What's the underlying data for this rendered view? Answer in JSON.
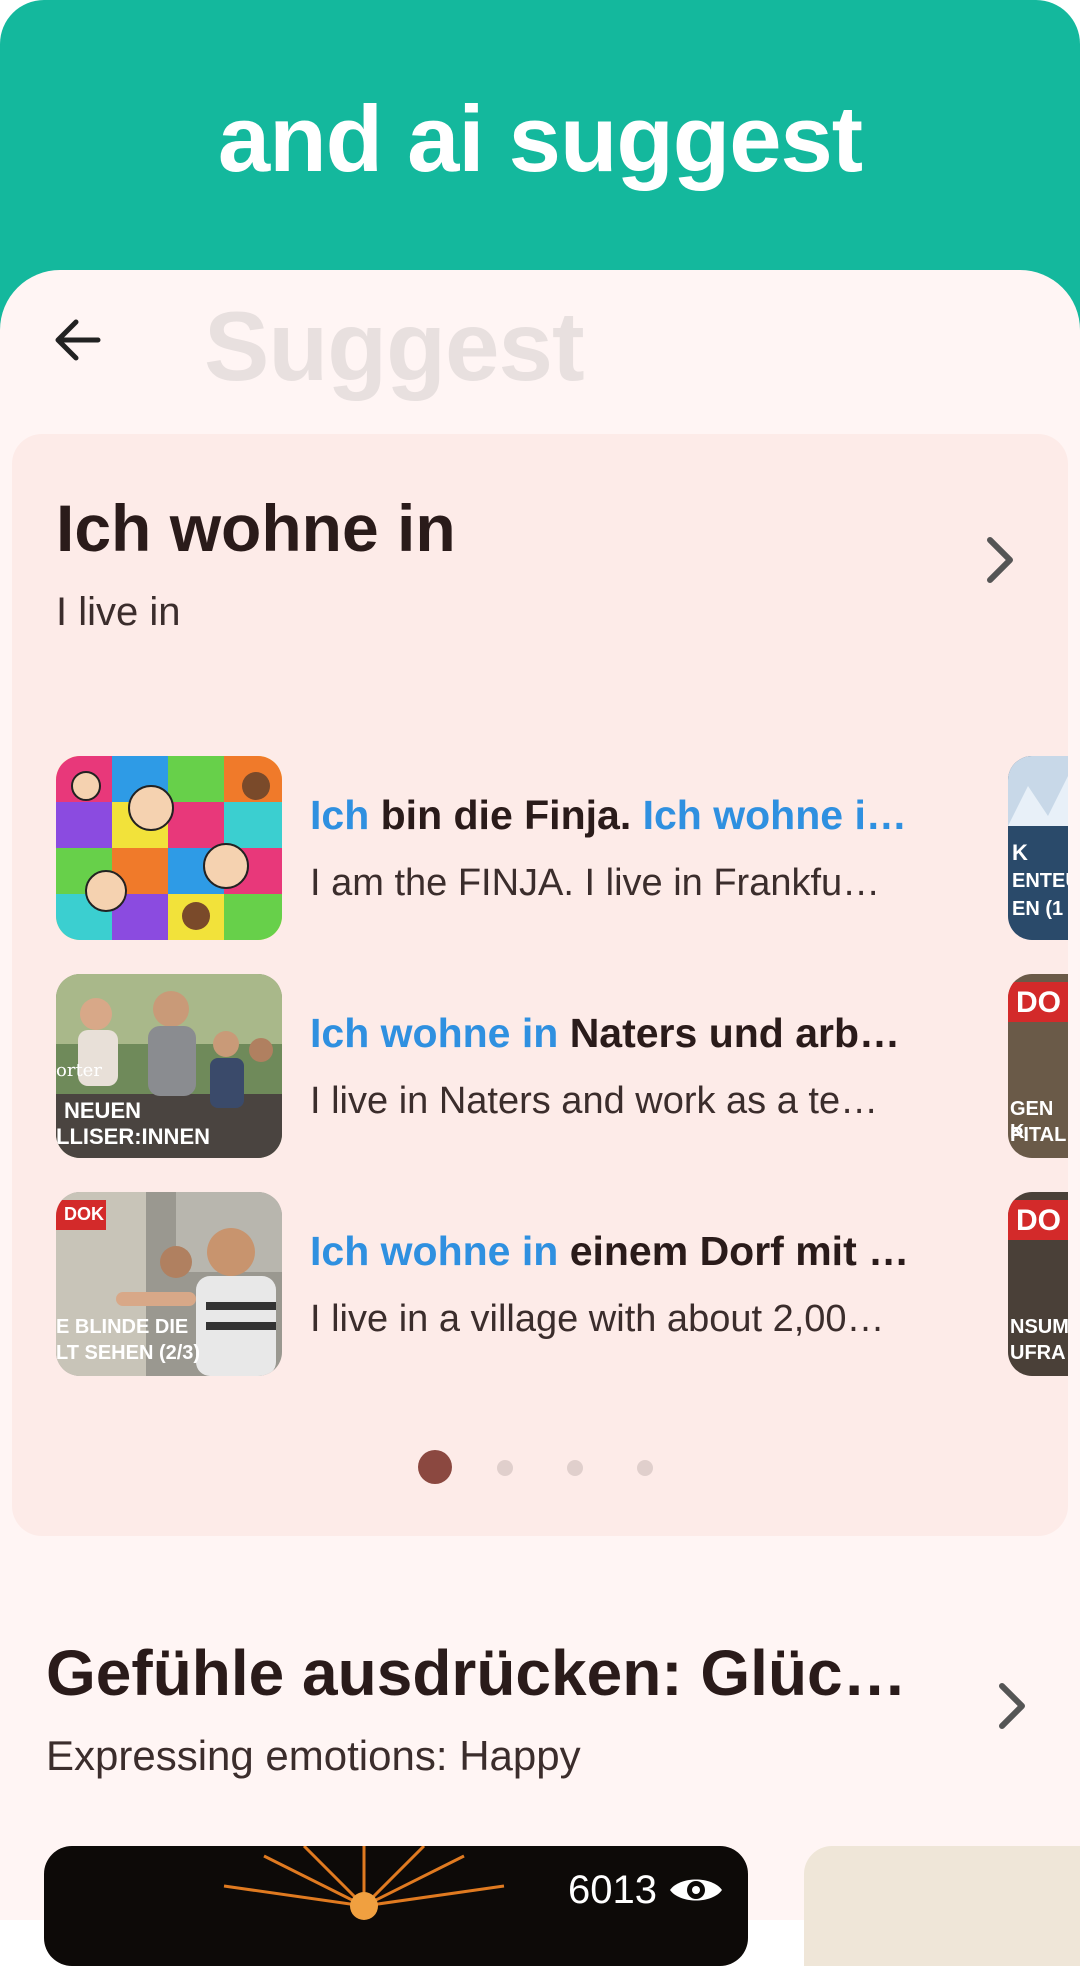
{
  "banner": {
    "title": "and ai suggest",
    "color": "#14b89d"
  },
  "header": {
    "ghost_title": "Suggest",
    "back_icon": "arrow-left-icon"
  },
  "section1": {
    "title": "Ich wohne in",
    "subtitle": "I live in",
    "items": [
      {
        "title_hl1": "Ich",
        "title_mid": " bin die Finja. ",
        "title_hl2": "Ich wohne i…",
        "subtitle": "I am the FINJA. I live in Frankfu…"
      },
      {
        "title_hl1": "Ich wohne in",
        "title_mid": " Naters und arb…",
        "title_hl2": "",
        "subtitle": "I live in Naters and work as a te…"
      },
      {
        "title_hl1": "Ich wohne in",
        "title_mid": " einem Dorf mit …",
        "title_hl2": "",
        "subtitle": "I live in a village with about 2,00…"
      }
    ],
    "thumb_texts": {
      "t2_line1": "orter",
      "t2_line2": "NEUEN",
      "t2_line3": "LLISER:INNEN",
      "t3_logo": "DOK",
      "t3_line1": "E BLINDE DIE",
      "t3_line2": "LT SEHEN (2/3)"
    },
    "peek_texts": {
      "p1_line1": "K",
      "p1_line2": "ENTEU",
      "p1_line3": "EN (1",
      "p2_logo": "DO",
      "p2_line1": "GEN K",
      "p2_line2": "PITAL",
      "p3_logo": "DO",
      "p3_line1": "NSUM",
      "p3_line2": "UFRA"
    },
    "pager": {
      "count": 4,
      "active_index": 0
    }
  },
  "section2": {
    "title": "Gefühle ausdrücken: Glüc…",
    "subtitle": "Expressing emotions: Happy",
    "video_views": "6013"
  }
}
